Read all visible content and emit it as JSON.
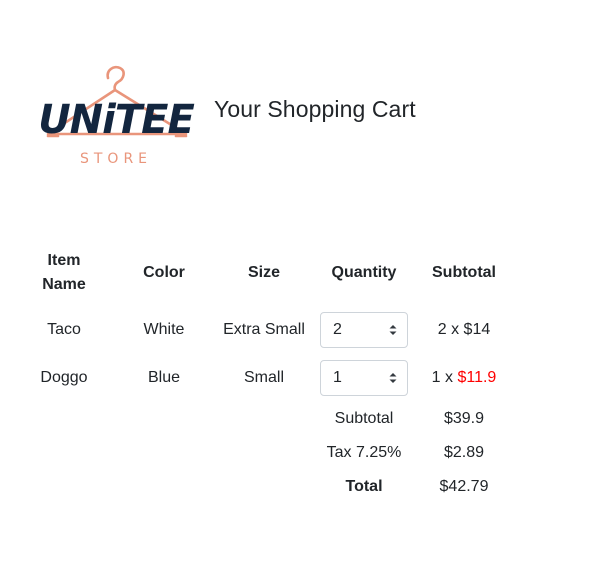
{
  "brand": {
    "logo_word": "UNiTEE",
    "logo_subword": "STORE",
    "logo_primary_color": "#13263f",
    "logo_accent_color": "#e9957b"
  },
  "page": {
    "title": "Your Shopping Cart"
  },
  "table": {
    "headers": {
      "item_name_line1": "Item",
      "item_name_line2": "Name",
      "color": "Color",
      "size": "Size",
      "quantity": "Quantity",
      "subtotal": "Subtotal"
    },
    "rows": [
      {
        "name": "Taco",
        "color": "White",
        "size": "Extra Small",
        "quantity": "2",
        "subtotal_prefix": "2 x ",
        "subtotal_price": "$14",
        "price_highlighted": false
      },
      {
        "name": "Doggo",
        "color": "Blue",
        "size": "Small",
        "quantity": "1",
        "subtotal_prefix": "1 x ",
        "subtotal_price": "$11.9",
        "price_highlighted": true
      }
    ]
  },
  "summary": {
    "subtotal_label": "Subtotal",
    "subtotal_value": "$39.9",
    "tax_label": "Tax 7.25%",
    "tax_value": "$2.89",
    "total_label": "Total",
    "total_value": "$42.79"
  },
  "colors": {
    "text": "#212529",
    "sale_price": "#ff0000",
    "select_border": "#ced4da"
  },
  "icons": {
    "select_arrows": "up-down-chevron-icon"
  }
}
